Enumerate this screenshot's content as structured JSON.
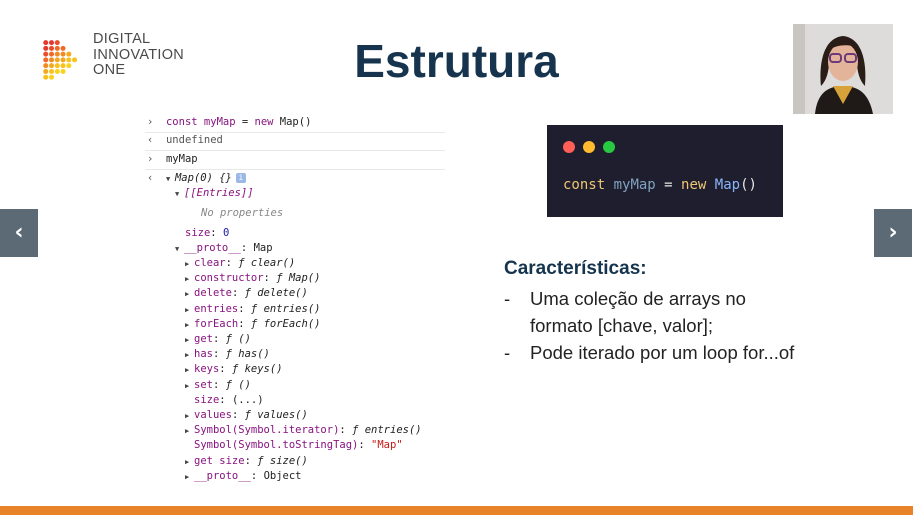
{
  "logo": {
    "line1": "DIGITAL",
    "line2": "INNOVATION",
    "line3": "ONE"
  },
  "slide": {
    "title": "Estrutura"
  },
  "console": {
    "l1_kw": "const",
    "l1_var": "myMap",
    "l1_eq": " = ",
    "l1_new": "new",
    "l1_call": " Map()",
    "l2": "undefined",
    "l3": "myMap",
    "l4": "Map(0) {}",
    "l4_badge": "i",
    "l5": "[[Entries]]",
    "l6": "No properties",
    "l7_key": "size",
    "l7_val": "0",
    "l8_key": "__proto__",
    "l8_val": "Map",
    "protos": [
      {
        "key": "clear",
        "val": "ƒ clear()"
      },
      {
        "key": "constructor",
        "val": "ƒ Map()"
      },
      {
        "key": "delete",
        "val": "ƒ delete()"
      },
      {
        "key": "entries",
        "val": "ƒ entries()"
      },
      {
        "key": "forEach",
        "val": "ƒ forEach()"
      },
      {
        "key": "get",
        "val": "ƒ ()"
      },
      {
        "key": "has",
        "val": "ƒ has()"
      },
      {
        "key": "keys",
        "val": "ƒ keys()"
      },
      {
        "key": "set",
        "val": "ƒ ()"
      },
      {
        "key": "size",
        "val": "(...)"
      },
      {
        "key": "values",
        "val": "ƒ values()"
      },
      {
        "key": "Symbol(Symbol.iterator)",
        "val": "ƒ entries()"
      },
      {
        "key": "Symbol(Symbol.toStringTag)",
        "val": "\"Map\""
      },
      {
        "key": "get size",
        "val": "ƒ size()"
      },
      {
        "key": "__proto__",
        "val": "Object"
      }
    ]
  },
  "code": {
    "kw": "const",
    "var": "myMap",
    "eq": " = ",
    "new": "new",
    "cls": "Map",
    "parens": "()"
  },
  "features": {
    "heading": "Características:",
    "b1_dash": "-",
    "b1_line1": "Uma coleção de arrays no",
    "b1_line2": "formato [chave, valor];",
    "b2_dash": "-",
    "b2_line1": "Pode iterado por um loop for...of"
  },
  "nav": {
    "prev": "‹",
    "next": "›"
  },
  "colors": {
    "title": "#16344e",
    "accent": "#e8832a",
    "code_bg": "#1e1e2e"
  }
}
